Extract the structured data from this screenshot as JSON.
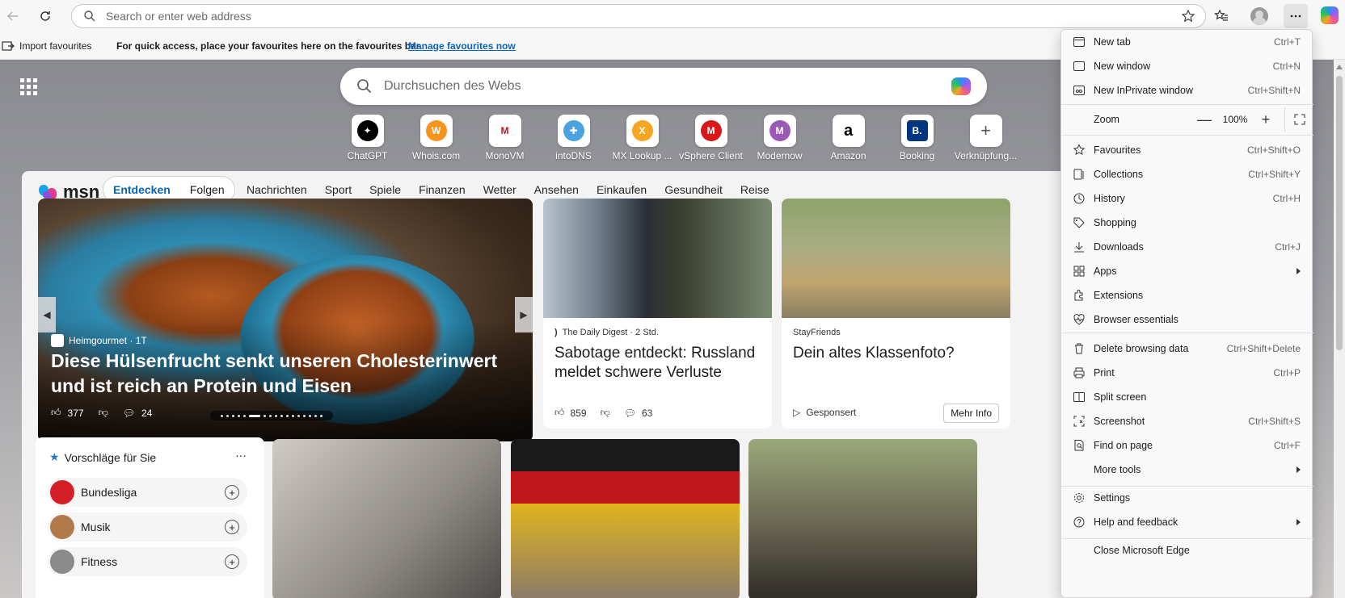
{
  "address_bar": {
    "placeholder": "Search or enter web address"
  },
  "favbar": {
    "import_label": "Import favourites",
    "hint": "For quick access, place your favourites here on the favourites bar.",
    "manage_link": "Manage favourites now"
  },
  "ntp_search": {
    "placeholder": "Durchsuchen des Webs"
  },
  "quick_links": [
    {
      "label": "ChatGPT",
      "icon": "chatgpt-icon",
      "color": "#000000",
      "glyph": "✦"
    },
    {
      "label": "Whois.com",
      "icon": "whois-icon",
      "color": "#f7941d",
      "glyph": "W"
    },
    {
      "label": "MonoVM",
      "icon": "monovm-icon",
      "color": "#ffffff",
      "glyph": "M"
    },
    {
      "label": "intoDNS",
      "icon": "intodns-icon",
      "color": "#4aa3df",
      "glyph": "✚"
    },
    {
      "label": "MX Lookup ...",
      "icon": "mxlookup-icon",
      "color": "#f5a623",
      "glyph": "X"
    },
    {
      "label": "vSphere Client",
      "icon": "vsphere-icon",
      "color": "#d7191c",
      "glyph": "M"
    },
    {
      "label": "Modernow",
      "icon": "modernow-icon",
      "color": "#9b59b6",
      "glyph": "M"
    },
    {
      "label": "Amazon",
      "icon": "amazon-icon",
      "color": "#000000",
      "glyph": "a"
    },
    {
      "label": "Booking",
      "icon": "booking-icon",
      "color": "#003580",
      "glyph": "B."
    },
    {
      "label": "Verknüpfung...",
      "icon": "add-shortcut-icon",
      "color": "#555555",
      "glyph": "+"
    }
  ],
  "msn": {
    "logo": "msn",
    "tabs": {
      "discover": "Entdecken",
      "follow": "Folgen"
    },
    "nav": [
      "Nachrichten",
      "Sport",
      "Spiele",
      "Finanzen",
      "Wetter",
      "Ansehen",
      "Einkaufen",
      "Gesundheit",
      "Reise"
    ],
    "hero": {
      "source": "Heimgourmet · 1T",
      "title": "Diese Hülsenfrucht senkt unseren Cholesterinwert und ist reich an Protein und Eisen",
      "likes": "377",
      "comments": "24"
    },
    "card1": {
      "source": "The Daily Digest · 2 Std.",
      "title": "Sabotage entdeckt: Russland meldet schwere Verluste",
      "likes": "859",
      "comments": "63"
    },
    "card2": {
      "source": "StayFriends",
      "title": "Dein altes Klassenfoto?",
      "sponsored": "Gesponsert",
      "cta": "Mehr Info"
    },
    "suggestions": {
      "title": "Vorschläge für Sie",
      "more": "···",
      "items": [
        "Bundesliga",
        "Musik",
        "Fitness"
      ]
    }
  },
  "menu": {
    "items": [
      {
        "label": "New tab",
        "shortcut": "Ctrl+T"
      },
      {
        "label": "New window",
        "shortcut": "Ctrl+N"
      },
      {
        "label": "New InPrivate window",
        "shortcut": "Ctrl+Shift+N"
      }
    ],
    "zoom": {
      "label": "Zoom",
      "value": "100%",
      "minus": "—",
      "plus": "+"
    },
    "items2": [
      {
        "label": "Favourites",
        "shortcut": "Ctrl+Shift+O"
      },
      {
        "label": "Collections",
        "shortcut": "Ctrl+Shift+Y"
      },
      {
        "label": "History",
        "shortcut": "Ctrl+H"
      },
      {
        "label": "Shopping",
        "shortcut": ""
      },
      {
        "label": "Downloads",
        "shortcut": "Ctrl+J"
      },
      {
        "label": "Apps",
        "shortcut": ""
      },
      {
        "label": "Extensions",
        "shortcut": ""
      },
      {
        "label": "Browser essentials",
        "shortcut": ""
      }
    ],
    "items3": [
      {
        "label": "Delete browsing data",
        "shortcut": "Ctrl+Shift+Delete"
      },
      {
        "label": "Print",
        "shortcut": "Ctrl+P"
      },
      {
        "label": "Split screen",
        "shortcut": ""
      },
      {
        "label": "Screenshot",
        "shortcut": "Ctrl+Shift+S"
      },
      {
        "label": "Find on page",
        "shortcut": "Ctrl+F"
      },
      {
        "label": "More tools",
        "shortcut": ""
      }
    ],
    "items4": [
      {
        "label": "Settings",
        "shortcut": ""
      },
      {
        "label": "Help and feedback",
        "shortcut": ""
      }
    ],
    "close": "Close Microsoft Edge"
  }
}
